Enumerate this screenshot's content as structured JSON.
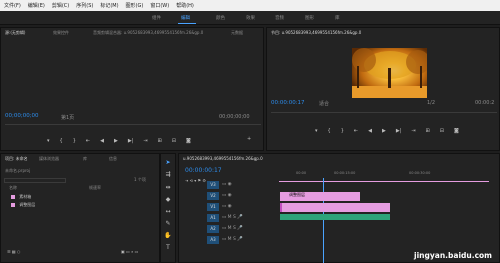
{
  "menu": [
    "文件(F)",
    "编辑(E)",
    "剪辑(C)",
    "序列(S)",
    "标记(M)",
    "图形(G)",
    "窗口(W)",
    "帮助(H)"
  ],
  "workspaces": [
    "组件",
    "编辑",
    "颜色",
    "效果",
    "音频",
    "图形",
    "库"
  ],
  "source_panel": {
    "tabs": [
      "源:(无剪辑)",
      "效果控件",
      "音频剪辑混合器: u.9052683993,4699554156fm.26&gp.0",
      "元数据"
    ],
    "timecode_left": "00;00;00;00",
    "page_label": "第1页",
    "timecode_right": "00;00;00;00"
  },
  "program_panel": {
    "title": "节目: u.9052683993,4699554156fm.26&gp.0",
    "timecode": "00:00:00:17",
    "fit": "适合",
    "scale": "1/2",
    "timecode_right": "00:00:2"
  },
  "project_panel": {
    "tabs": [
      "项目: 未命名",
      "媒体浏览器",
      "库",
      "信息"
    ],
    "project_file": "未命名.prproj",
    "item_count": "1 个项",
    "col_name": "名称",
    "col_fps": "帧速率",
    "items": [
      {
        "name": "素材箱",
        "color": "#e59ce0"
      },
      {
        "name": "调整图层",
        "color": "#e59ce0"
      }
    ]
  },
  "timeline": {
    "tab": "u.9052683993,4699554156fm.26&gp.0",
    "timecode": "00:00:00:17",
    "ruler": [
      "00:00",
      "00:00:15:00",
      "00:00:30:00"
    ],
    "tracks": [
      {
        "label": "V3",
        "type": "v"
      },
      {
        "label": "V2",
        "type": "v"
      },
      {
        "label": "V1",
        "type": "v"
      },
      {
        "label": "A1",
        "type": "a"
      },
      {
        "label": "A2",
        "type": "a"
      },
      {
        "label": "A3",
        "type": "a"
      }
    ],
    "clip_adjust_label": "调整图层",
    "clip_colors": {
      "pink": "#e59ce0",
      "green": "#2ea37a"
    }
  },
  "watermark": "jingyan.baidu.com"
}
